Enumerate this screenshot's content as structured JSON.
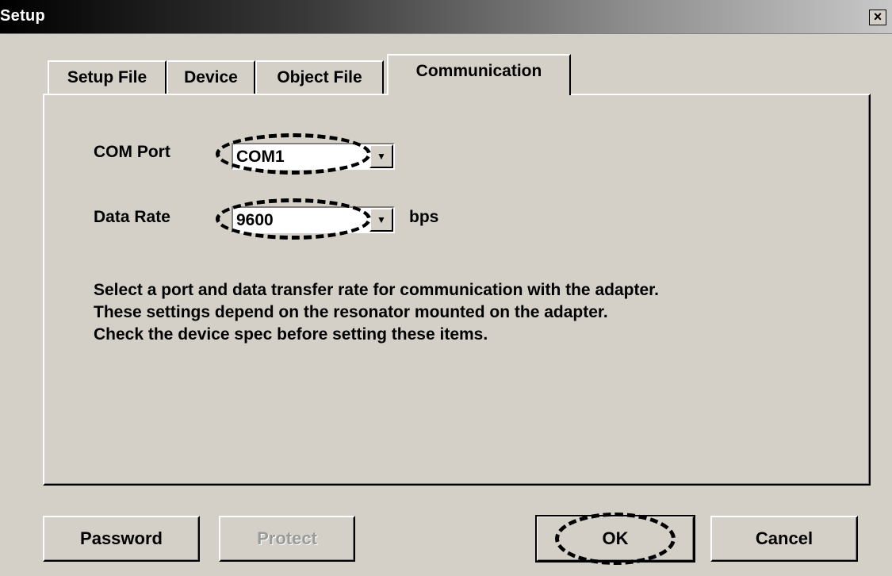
{
  "window": {
    "title": "Setup",
    "close_glyph": "×"
  },
  "tabs": [
    {
      "label": "Setup File"
    },
    {
      "label": "Device"
    },
    {
      "label": "Object File"
    },
    {
      "label": "Communication",
      "selected": true
    }
  ],
  "communication": {
    "com_port": {
      "label": "COM Port",
      "value": "COM1"
    },
    "data_rate": {
      "label": "Data Rate",
      "value": "9600",
      "unit": "bps"
    },
    "description": [
      "Select a port and data transfer rate for communication with the adapter.",
      "These settings depend on the resonator mounted on the adapter.",
      "Check the device spec before setting these items."
    ]
  },
  "buttons": {
    "password": "Password",
    "protect": "Protect",
    "ok": "OK",
    "cancel": "Cancel"
  },
  "icons": {
    "dropdown_arrow": "▼"
  }
}
